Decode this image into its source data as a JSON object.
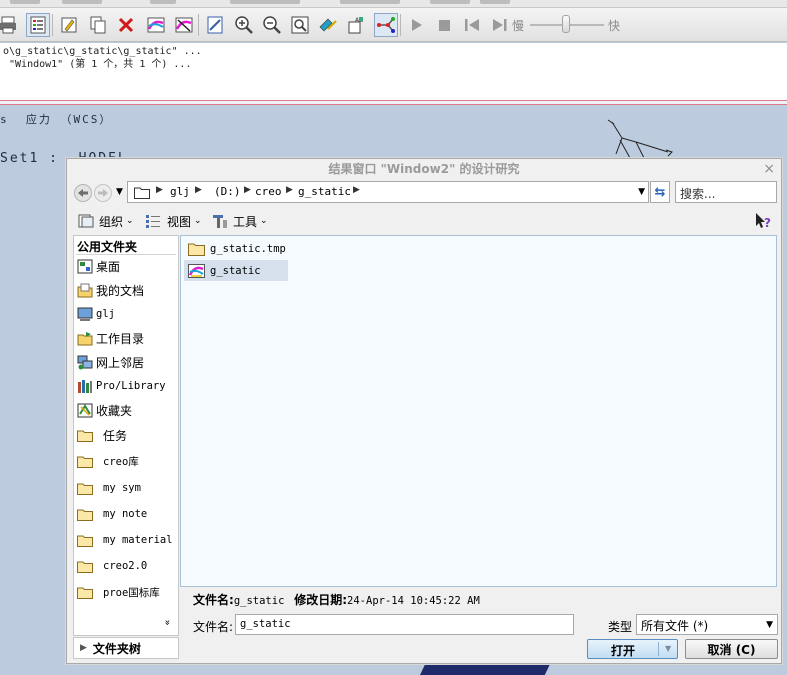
{
  "toolbar": {
    "speed_slow": "慢",
    "speed_fast": "快",
    "icons": [
      "print-icon",
      "open-results-icon",
      "edit-definition-icon",
      "copy-icon",
      "delete-icon",
      "display-options-icon",
      "display-options-2-icon",
      "info-icon",
      "zoom-in-icon",
      "zoom-out-icon",
      "refit-icon",
      "query-icon",
      "model-label-icon",
      "graph-tool-icon",
      "play-icon",
      "stop-icon",
      "first-frame-icon",
      "next-frame-icon"
    ]
  },
  "message_area": {
    "lines": [
      "o\\g_static\\g_static\\g_static\" ...",
      " \"Window1\" (第 1 个，共 1 个) ..."
    ]
  },
  "graphics": {
    "quantity_label": "s  应力 （WCS）",
    "set_label": "Set1 :  HODEL"
  },
  "dialog": {
    "title": "结果窗口 \"Window2\" 的设计研究",
    "close": "×",
    "address_crumbs": [
      "glj",
      "(D:)",
      "creo",
      "g_static"
    ],
    "search_placeholder": "搜索...",
    "commands": {
      "organize": "组织",
      "views": "视图",
      "tools": "工具"
    },
    "sidebar": {
      "heading": "公用文件夹",
      "items": [
        {
          "label": "桌面",
          "icon": "desktop-icon"
        },
        {
          "label": "我的文档",
          "icon": "my-documents-icon"
        },
        {
          "label": "glj",
          "icon": "computer-icon"
        },
        {
          "label": "工作目录",
          "icon": "working-directory-icon"
        },
        {
          "label": "网上邻居",
          "icon": "network-icon"
        },
        {
          "label": "Pro/Library",
          "icon": "library-icon"
        },
        {
          "label": "收藏夹",
          "icon": "favorites-icon"
        },
        {
          "label": "任务",
          "icon": "folder-icon"
        },
        {
          "label": "creo库",
          "icon": "folder-icon"
        },
        {
          "label": "my sym",
          "icon": "folder-icon"
        },
        {
          "label": "my note",
          "icon": "folder-icon"
        },
        {
          "label": "my material",
          "icon": "folder-icon"
        },
        {
          "label": "creo2.0",
          "icon": "folder-icon"
        },
        {
          "label": "proe国标库",
          "icon": "folder-icon"
        }
      ],
      "more": "»"
    },
    "folder_tree": "文件夹树",
    "files": [
      {
        "name": "g_static.tmp",
        "icon": "folder-icon",
        "selected": false
      },
      {
        "name": "g_static",
        "icon": "results-file-icon",
        "selected": true
      }
    ],
    "info": {
      "name_label": "文件名:",
      "name_value": "g_static",
      "date_label": "修改日期:",
      "date_value": "24-Apr-14 10:45:22 AM"
    },
    "filename_label": "文件名:",
    "filename_value": "g_static",
    "type_label": "类型",
    "type_value": "所有文件 (*)",
    "open_button": "打开",
    "cancel_button": "取消 (C)"
  }
}
